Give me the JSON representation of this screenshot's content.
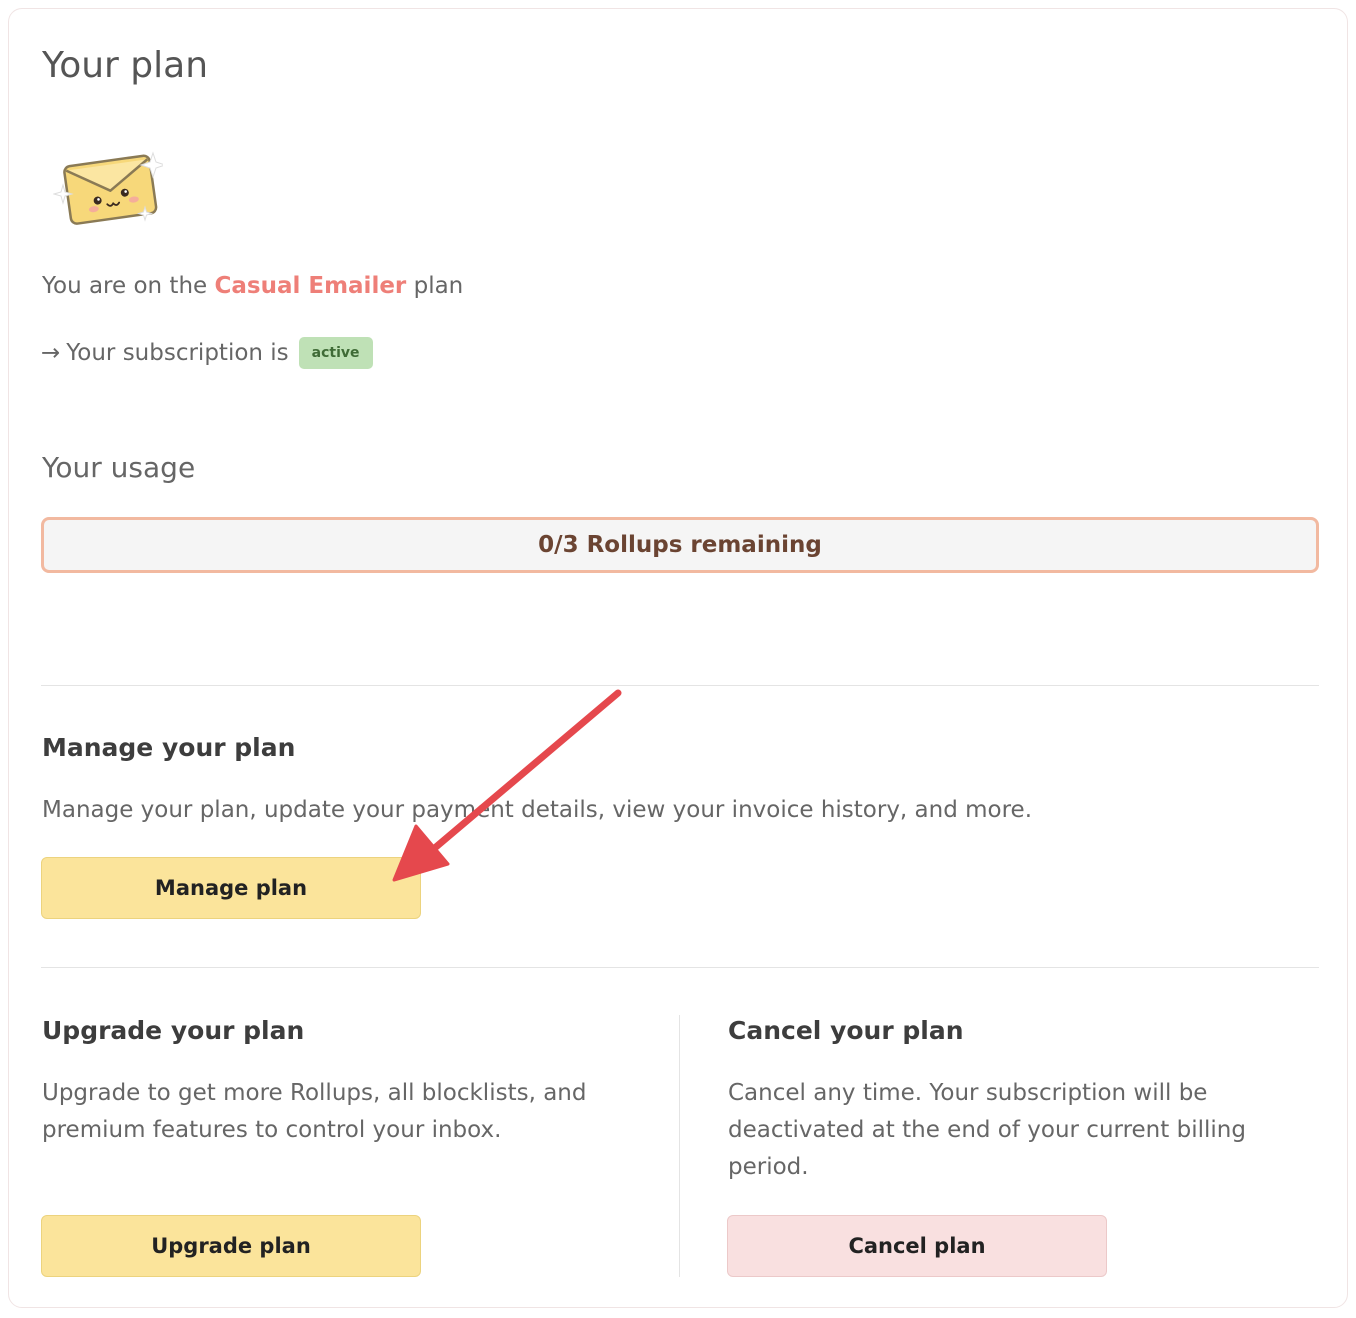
{
  "header": {
    "title": "Your plan"
  },
  "plan": {
    "prefix": "You are on the",
    "name": "Casual Emailer",
    "suffix": "plan",
    "name_color": "#ee7f78"
  },
  "subscription": {
    "arrow": "→",
    "label": "Your subscription is",
    "status": "active"
  },
  "usage": {
    "title": "Your usage",
    "text": "0/3 Rollups remaining",
    "used": 0,
    "total": 3
  },
  "manage": {
    "title": "Manage your plan",
    "description": "Manage your plan, update your payment details, view your invoice history, and more.",
    "button_label": "Manage plan"
  },
  "upgrade": {
    "title": "Upgrade your plan",
    "description": "Upgrade to get more Rollups, all blocklists, and premium features to control your inbox.",
    "button_label": "Upgrade plan"
  },
  "cancel": {
    "title": "Cancel your plan",
    "description": "Cancel any time. Your subscription will be deactivated at the end of your current billing period.",
    "button_label": "Cancel plan"
  },
  "icons": {
    "mascot": "envelope-mascot-icon",
    "annotation": "red-arrow-icon"
  },
  "colors": {
    "accent": "#ee7f78",
    "active_badge": "#bfe1b6",
    "primary_button": "#fbe49b",
    "danger_button": "#f9e0e0",
    "usage_border": "#f2b9a0",
    "annotation_arrow": "#e5484d"
  }
}
